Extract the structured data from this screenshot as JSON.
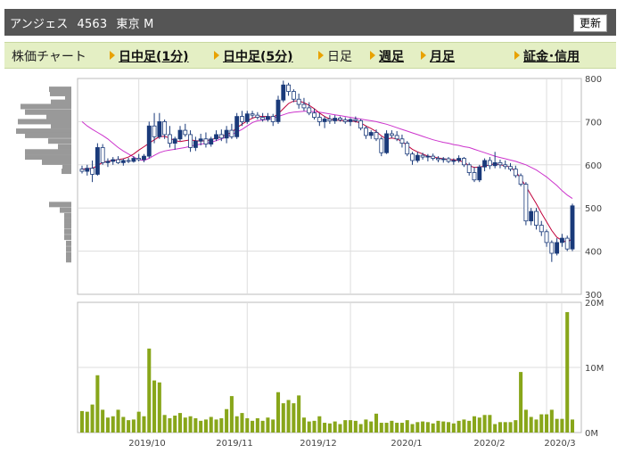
{
  "header": {
    "name": "アンジェス",
    "code": "4563",
    "market": "東京 M",
    "refresh_label": "更新"
  },
  "tabs": [
    {
      "label": "株価チャート",
      "arrow": false,
      "link": false,
      "x": 8
    },
    {
      "label": "日中足(1分)",
      "arrow": true,
      "link": true,
      "x": 118
    },
    {
      "label": "日中足(5分)",
      "arrow": true,
      "link": true,
      "x": 235
    },
    {
      "label": "日足",
      "arrow": true,
      "link": false,
      "x": 352
    },
    {
      "label": "週足",
      "arrow": true,
      "link": true,
      "x": 410
    },
    {
      "label": "月足",
      "arrow": true,
      "link": true,
      "x": 467
    },
    {
      "label": "証金･信用",
      "arrow": true,
      "link": true,
      "x": 572
    }
  ],
  "colors": {
    "up": "#1a3a7a",
    "down": "#ffffff",
    "ma_short": "#c0003a",
    "ma_long": "#cc33cc",
    "volume": "#88a61a",
    "profile": "#999999"
  },
  "chart_data": {
    "type": "candlestick",
    "price_axis": {
      "ylim": [
        300,
        800
      ],
      "ticks": [
        300,
        400,
        500,
        600,
        700,
        800
      ]
    },
    "volume_axis": {
      "ylim": [
        0,
        20000000
      ],
      "ticks": [
        "0M",
        "10M",
        "20M"
      ]
    },
    "month_labels": [
      "2019/10",
      "2019/11",
      "2019/12",
      "2020/1",
      "2020/2",
      "2020/3"
    ],
    "candles": [
      {
        "o": 590,
        "h": 598,
        "l": 580,
        "c": 585
      },
      {
        "o": 585,
        "h": 600,
        "l": 575,
        "c": 592
      },
      {
        "o": 592,
        "h": 610,
        "l": 560,
        "c": 578
      },
      {
        "o": 578,
        "h": 650,
        "l": 575,
        "c": 640
      },
      {
        "o": 640,
        "h": 648,
        "l": 600,
        "c": 605
      },
      {
        "o": 605,
        "h": 615,
        "l": 595,
        "c": 608
      },
      {
        "o": 608,
        "h": 618,
        "l": 600,
        "c": 612
      },
      {
        "o": 612,
        "h": 620,
        "l": 602,
        "c": 605
      },
      {
        "o": 605,
        "h": 614,
        "l": 598,
        "c": 610
      },
      {
        "o": 610,
        "h": 616,
        "l": 604,
        "c": 608
      },
      {
        "o": 608,
        "h": 620,
        "l": 605,
        "c": 615
      },
      {
        "o": 615,
        "h": 625,
        "l": 608,
        "c": 612
      },
      {
        "o": 612,
        "h": 625,
        "l": 606,
        "c": 620
      },
      {
        "o": 620,
        "h": 700,
        "l": 615,
        "c": 690
      },
      {
        "o": 690,
        "h": 720,
        "l": 650,
        "c": 665
      },
      {
        "o": 665,
        "h": 720,
        "l": 660,
        "c": 700
      },
      {
        "o": 700,
        "h": 705,
        "l": 660,
        "c": 670
      },
      {
        "o": 670,
        "h": 690,
        "l": 640,
        "c": 650
      },
      {
        "o": 650,
        "h": 665,
        "l": 635,
        "c": 660
      },
      {
        "o": 660,
        "h": 690,
        "l": 655,
        "c": 680
      },
      {
        "o": 680,
        "h": 695,
        "l": 665,
        "c": 670
      },
      {
        "o": 670,
        "h": 680,
        "l": 630,
        "c": 640
      },
      {
        "o": 640,
        "h": 665,
        "l": 632,
        "c": 655
      },
      {
        "o": 655,
        "h": 672,
        "l": 645,
        "c": 660
      },
      {
        "o": 660,
        "h": 675,
        "l": 640,
        "c": 648
      },
      {
        "o": 648,
        "h": 665,
        "l": 642,
        "c": 660
      },
      {
        "o": 660,
        "h": 680,
        "l": 655,
        "c": 670
      },
      {
        "o": 670,
        "h": 682,
        "l": 655,
        "c": 662
      },
      {
        "o": 662,
        "h": 690,
        "l": 650,
        "c": 680
      },
      {
        "o": 680,
        "h": 695,
        "l": 660,
        "c": 665
      },
      {
        "o": 665,
        "h": 720,
        "l": 660,
        "c": 712
      },
      {
        "o": 712,
        "h": 725,
        "l": 690,
        "c": 700
      },
      {
        "o": 700,
        "h": 725,
        "l": 695,
        "c": 718
      },
      {
        "o": 718,
        "h": 725,
        "l": 708,
        "c": 715
      },
      {
        "o": 715,
        "h": 722,
        "l": 705,
        "c": 710
      },
      {
        "o": 710,
        "h": 720,
        "l": 700,
        "c": 705
      },
      {
        "o": 705,
        "h": 720,
        "l": 700,
        "c": 712
      },
      {
        "o": 712,
        "h": 718,
        "l": 690,
        "c": 700
      },
      {
        "o": 700,
        "h": 760,
        "l": 695,
        "c": 750
      },
      {
        "o": 750,
        "h": 795,
        "l": 745,
        "c": 785
      },
      {
        "o": 785,
        "h": 790,
        "l": 760,
        "c": 770
      },
      {
        "o": 770,
        "h": 775,
        "l": 745,
        "c": 752
      },
      {
        "o": 752,
        "h": 765,
        "l": 730,
        "c": 740
      },
      {
        "o": 740,
        "h": 755,
        "l": 725,
        "c": 732
      },
      {
        "o": 732,
        "h": 745,
        "l": 715,
        "c": 720
      },
      {
        "o": 720,
        "h": 730,
        "l": 705,
        "c": 710
      },
      {
        "o": 710,
        "h": 720,
        "l": 690,
        "c": 700
      },
      {
        "o": 700,
        "h": 712,
        "l": 685,
        "c": 706
      },
      {
        "o": 706,
        "h": 715,
        "l": 695,
        "c": 702
      },
      {
        "o": 702,
        "h": 715,
        "l": 695,
        "c": 708
      },
      {
        "o": 708,
        "h": 712,
        "l": 700,
        "c": 704
      },
      {
        "o": 704,
        "h": 710,
        "l": 695,
        "c": 700
      },
      {
        "o": 700,
        "h": 708,
        "l": 690,
        "c": 705
      },
      {
        "o": 705,
        "h": 712,
        "l": 698,
        "c": 702
      },
      {
        "o": 702,
        "h": 706,
        "l": 680,
        "c": 685
      },
      {
        "o": 685,
        "h": 690,
        "l": 660,
        "c": 668
      },
      {
        "o": 668,
        "h": 680,
        "l": 660,
        "c": 675
      },
      {
        "o": 675,
        "h": 682,
        "l": 655,
        "c": 660
      },
      {
        "o": 660,
        "h": 665,
        "l": 620,
        "c": 628
      },
      {
        "o": 628,
        "h": 680,
        "l": 625,
        "c": 672
      },
      {
        "o": 672,
        "h": 680,
        "l": 662,
        "c": 668
      },
      {
        "o": 668,
        "h": 678,
        "l": 655,
        "c": 660
      },
      {
        "o": 660,
        "h": 670,
        "l": 640,
        "c": 650
      },
      {
        "o": 650,
        "h": 655,
        "l": 620,
        "c": 625
      },
      {
        "o": 625,
        "h": 630,
        "l": 600,
        "c": 610
      },
      {
        "o": 610,
        "h": 630,
        "l": 605,
        "c": 622
      },
      {
        "o": 622,
        "h": 628,
        "l": 612,
        "c": 618
      },
      {
        "o": 618,
        "h": 625,
        "l": 608,
        "c": 620
      },
      {
        "o": 620,
        "h": 626,
        "l": 610,
        "c": 615
      },
      {
        "o": 615,
        "h": 620,
        "l": 606,
        "c": 612
      },
      {
        "o": 612,
        "h": 618,
        "l": 605,
        "c": 614
      },
      {
        "o": 614,
        "h": 618,
        "l": 604,
        "c": 608
      },
      {
        "o": 608,
        "h": 615,
        "l": 600,
        "c": 610
      },
      {
        "o": 610,
        "h": 622,
        "l": 605,
        "c": 615
      },
      {
        "o": 615,
        "h": 618,
        "l": 595,
        "c": 600
      },
      {
        "o": 600,
        "h": 605,
        "l": 575,
        "c": 582
      },
      {
        "o": 582,
        "h": 595,
        "l": 560,
        "c": 565
      },
      {
        "o": 565,
        "h": 600,
        "l": 560,
        "c": 595
      },
      {
        "o": 595,
        "h": 615,
        "l": 585,
        "c": 610
      },
      {
        "o": 610,
        "h": 618,
        "l": 590,
        "c": 598
      },
      {
        "o": 598,
        "h": 630,
        "l": 592,
        "c": 605
      },
      {
        "o": 605,
        "h": 612,
        "l": 592,
        "c": 600
      },
      {
        "o": 600,
        "h": 610,
        "l": 590,
        "c": 596
      },
      {
        "o": 596,
        "h": 604,
        "l": 585,
        "c": 590
      },
      {
        "o": 590,
        "h": 598,
        "l": 570,
        "c": 575
      },
      {
        "o": 575,
        "h": 580,
        "l": 550,
        "c": 555
      },
      {
        "o": 555,
        "h": 560,
        "l": 460,
        "c": 470
      },
      {
        "o": 470,
        "h": 500,
        "l": 460,
        "c": 492
      },
      {
        "o": 492,
        "h": 500,
        "l": 450,
        "c": 460
      },
      {
        "o": 460,
        "h": 470,
        "l": 435,
        "c": 445
      },
      {
        "o": 445,
        "h": 450,
        "l": 410,
        "c": 420
      },
      {
        "o": 420,
        "h": 425,
        "l": 375,
        "c": 395
      },
      {
        "o": 395,
        "h": 430,
        "l": 390,
        "c": 420
      },
      {
        "o": 420,
        "h": 440,
        "l": 410,
        "c": 430
      },
      {
        "o": 430,
        "h": 436,
        "l": 400,
        "c": 405
      },
      {
        "o": 405,
        "h": 510,
        "l": 400,
        "c": 505
      }
    ],
    "ma_short": [
      590,
      591,
      592,
      598,
      606,
      608,
      610,
      612,
      614,
      618,
      625,
      634,
      642,
      650,
      658,
      665,
      666,
      662,
      656,
      654,
      656,
      658,
      656,
      655,
      656,
      658,
      662,
      665,
      670,
      675,
      686,
      694,
      702,
      708,
      712,
      712,
      712,
      710,
      718,
      730,
      742,
      748,
      748,
      744,
      738,
      730,
      720,
      712,
      706,
      704,
      703,
      702,
      702,
      700,
      697,
      690,
      684,
      677,
      667,
      660,
      662,
      660,
      654,
      645,
      636,
      630,
      625,
      620,
      618,
      616,
      614,
      612,
      612,
      610,
      606,
      598,
      594,
      595,
      597,
      600,
      602,
      600,
      598,
      594,
      585,
      568,
      550,
      530,
      510,
      488,
      468,
      448,
      432,
      425,
      420,
      430
    ],
    "ma_long": [
      700,
      690,
      682,
      675,
      668,
      660,
      650,
      640,
      632,
      625,
      618,
      612,
      610,
      615,
      622,
      628,
      632,
      634,
      636,
      638,
      640,
      643,
      646,
      648,
      650,
      652,
      656,
      660,
      665,
      670,
      676,
      682,
      690,
      698,
      702,
      704,
      705,
      708,
      712,
      716,
      720,
      722,
      723,
      724,
      724,
      723,
      722,
      720,
      718,
      716,
      714,
      712,
      710,
      708,
      706,
      704,
      702,
      700,
      697,
      694,
      690,
      686,
      682,
      678,
      674,
      670,
      666,
      662,
      658,
      655,
      652,
      650,
      647,
      645,
      642,
      640,
      636,
      632,
      628,
      624,
      620,
      617,
      614,
      611,
      608,
      604,
      600,
      594,
      588,
      580,
      572,
      562,
      552,
      540,
      530,
      522
    ],
    "volume": [
      3.3,
      3.2,
      4.3,
      8.8,
      3.5,
      2.3,
      2.5,
      3.5,
      2.4,
      1.9,
      2.0,
      3.2,
      2.5,
      12.9,
      8.0,
      7.7,
      2.7,
      2.2,
      2.6,
      3.0,
      2.3,
      2.5,
      2.2,
      1.8,
      2.0,
      2.4,
      2.0,
      2.2,
      3.6,
      5.6,
      2.5,
      3.0,
      2.2,
      1.8,
      2.2,
      1.8,
      2.3,
      2.0,
      6.2,
      4.5,
      5.0,
      4.5,
      5.7,
      2.3,
      1.7,
      1.8,
      2.5,
      1.5,
      1.4,
      1.7,
      1.3,
      1.9,
      1.9,
      1.8,
      1.3,
      2.0,
      1.7,
      2.9,
      1.5,
      1.5,
      1.8,
      1.5,
      1.5,
      1.9,
      1.3,
      1.6,
      1.7,
      1.6,
      1.4,
      1.8,
      1.7,
      1.6,
      1.4,
      1.8,
      2.0,
      1.8,
      2.5,
      2.3,
      2.7,
      2.7,
      1.3,
      1.6,
      1.6,
      1.6,
      1.9,
      9.3,
      3.5,
      2.4,
      2.0,
      2.8,
      2.8,
      3.5,
      2.1,
      2.1,
      18.5,
      2.0
    ],
    "volume_profile": [
      {
        "price": 775,
        "w": 25
      },
      {
        "price": 765,
        "w": 24
      },
      {
        "price": 755,
        "w": 7
      },
      {
        "price": 745,
        "w": 23
      },
      {
        "price": 735,
        "w": 57
      },
      {
        "price": 722,
        "w": 52
      },
      {
        "price": 712,
        "w": 28
      },
      {
        "price": 700,
        "w": 60
      },
      {
        "price": 690,
        "w": 23
      },
      {
        "price": 678,
        "w": 62
      },
      {
        "price": 668,
        "w": 52
      },
      {
        "price": 655,
        "w": 26
      },
      {
        "price": 642,
        "w": 15
      },
      {
        "price": 630,
        "w": 52
      },
      {
        "price": 618,
        "w": 52
      },
      {
        "price": 606,
        "w": 33
      },
      {
        "price": 594,
        "w": 10
      },
      {
        "price": 585,
        "w": 11
      },
      {
        "price": 508,
        "w": 25
      },
      {
        "price": 495,
        "w": 13
      },
      {
        "price": 482,
        "w": 8
      },
      {
        "price": 470,
        "w": 8
      },
      {
        "price": 458,
        "w": 8
      },
      {
        "price": 445,
        "w": 8
      },
      {
        "price": 432,
        "w": 8
      },
      {
        "price": 418,
        "w": 6
      },
      {
        "price": 405,
        "w": 6
      },
      {
        "price": 392,
        "w": 6
      },
      {
        "price": 380,
        "w": 6
      }
    ]
  }
}
